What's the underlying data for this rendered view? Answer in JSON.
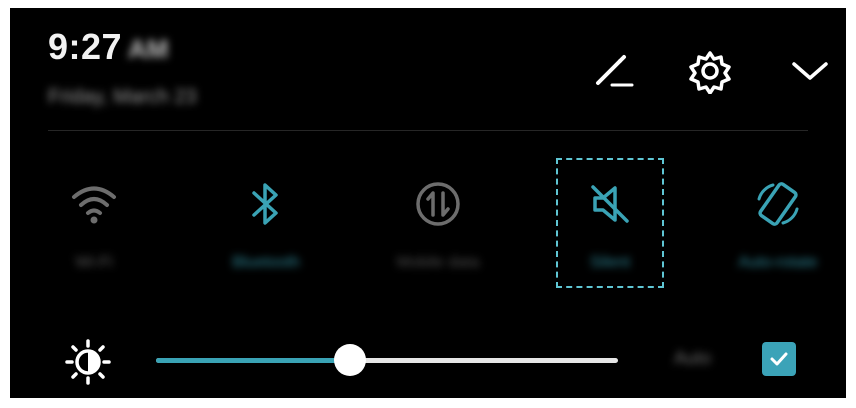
{
  "header": {
    "time": "9:27",
    "ampm": "AM",
    "date": "Friday, March 23"
  },
  "tiles": [
    {
      "label": "Wi-Fi",
      "state": "off",
      "icon": "wifi-icon"
    },
    {
      "label": "Bluetooth",
      "state": "on",
      "icon": "bluetooth-icon"
    },
    {
      "label": "Mobile data",
      "state": "off",
      "icon": "mobile-data-icon"
    },
    {
      "label": "Silent",
      "state": "on",
      "icon": "silent-icon",
      "highlighted": true
    },
    {
      "label": "Auto-rotate",
      "state": "on",
      "icon": "auto-rotate-icon"
    }
  ],
  "brightness": {
    "level_percent": 42,
    "auto_label": "Auto",
    "auto_checked": true
  },
  "colors": {
    "background": "#000000",
    "accent": "#3aa3b5",
    "inactive": "#6d6d6d",
    "text": "#f2f2f2"
  }
}
